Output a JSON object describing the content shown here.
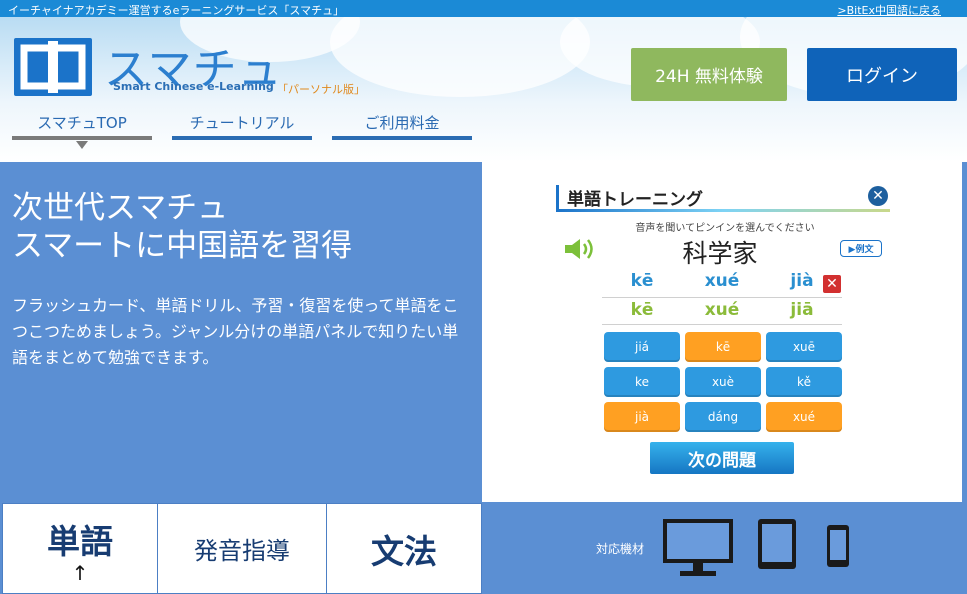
{
  "topbar": {
    "tagline": "イーチャイナアカデミー運営するeラーニングサービス「スマチュ」",
    "back_link": ">BitEx中国語に戻る"
  },
  "header": {
    "logo_title": "スマチュ",
    "logo_subtitle": "Smart Chinese e-Learning",
    "edition": "「パーソナル版」",
    "trial_button": "24H 無料体験",
    "login_button": "ログイン",
    "nav": [
      {
        "label": "スマチュTOP",
        "active": true
      },
      {
        "label": "チュートリアル",
        "active": false
      },
      {
        "label": "ご利用料金",
        "active": false
      }
    ]
  },
  "hero": {
    "title_line1": "次世代スマチュ",
    "title_line2": "スマートに中国語を習得",
    "description": "フラッシュカード、単語ドリル、予習・復習を使って単語をこつこつためましょう。ジャンル分けの単語パネルで知りたい単語をまとめて勉強できます。"
  },
  "training_panel": {
    "title": "単語トレーニング",
    "close_symbol": "✕",
    "instruction": "音声を聞いてピンインを選んでください",
    "word": "科学家",
    "example_button": "▶例文",
    "answer_pinyin": [
      "kē",
      "xué",
      "jià"
    ],
    "correct_pinyin": [
      "kē",
      "xué",
      "jiā"
    ],
    "wrong_mark": "✕",
    "choices": [
      {
        "label": "jiá",
        "color": "blue"
      },
      {
        "label": "kē",
        "color": "orange"
      },
      {
        "label": "xuē",
        "color": "blue"
      },
      {
        "label": "ke",
        "color": "blue"
      },
      {
        "label": "xuè",
        "color": "blue"
      },
      {
        "label": "kě",
        "color": "blue"
      },
      {
        "label": "jià",
        "color": "orange"
      },
      {
        "label": "dáng",
        "color": "blue"
      },
      {
        "label": "xué",
        "color": "orange"
      }
    ],
    "next_button": "次の問題"
  },
  "features": [
    {
      "label": "単語",
      "arrow": "↑"
    },
    {
      "label": "発音指導"
    },
    {
      "label": "文法"
    }
  ],
  "devices": {
    "label": "対応機材",
    "icons": [
      "monitor-icon",
      "tablet-icon",
      "smartphone-icon"
    ]
  },
  "colors": {
    "topbar": "#1b8ad6",
    "hero": "#5b8fd3",
    "trial": "#8fb85e",
    "login": "#0f63b9",
    "choice_blue": "#2e9ae0",
    "choice_orange": "#ffa022"
  }
}
